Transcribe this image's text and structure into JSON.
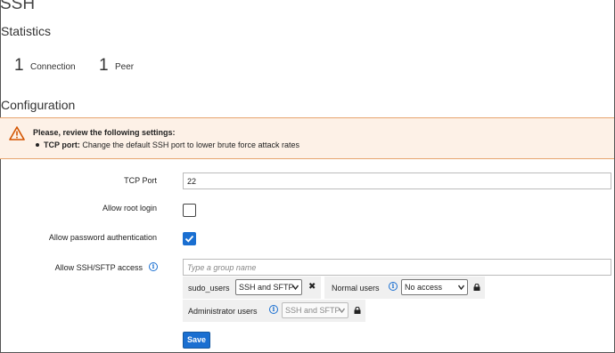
{
  "page": {
    "title": "SSH"
  },
  "statistics": {
    "heading": "Statistics",
    "connections": {
      "value": "1",
      "label": "Connection"
    },
    "peers": {
      "value": "1",
      "label": "Peer"
    }
  },
  "configuration": {
    "heading": "Configuration",
    "warning": {
      "title": "Please, review the following settings:",
      "item_key": "TCP port:",
      "item_text": "Change the default SSH port to lower brute force attack rates",
      "color": "#fdf1e7",
      "border_color": "#e7a56f"
    },
    "tcp_port": {
      "label": "TCP Port",
      "value": "22"
    },
    "allow_root": {
      "label": "Allow root login",
      "checked": false
    },
    "allow_password": {
      "label": "Allow password authentication",
      "checked": true
    },
    "access": {
      "label": "Allow SSH/SFTP access",
      "placeholder": "Type a group name",
      "groups": [
        {
          "name": "sudo_users",
          "selected": "SSH and SFTP",
          "removable": true
        },
        {
          "name": "Normal users",
          "selected": "No access",
          "locked": true
        },
        {
          "name": "Administrator users",
          "selected": "SSH and SFTP",
          "locked": true,
          "disabled": true
        }
      ]
    },
    "save_label": "Save"
  },
  "colors": {
    "accent": "#1a6fd1",
    "warning": "#e67e22"
  },
  "icons": [
    "warning-icon",
    "info-icon",
    "close-icon",
    "lock-icon",
    "chevron-down-icon",
    "check-icon"
  ]
}
